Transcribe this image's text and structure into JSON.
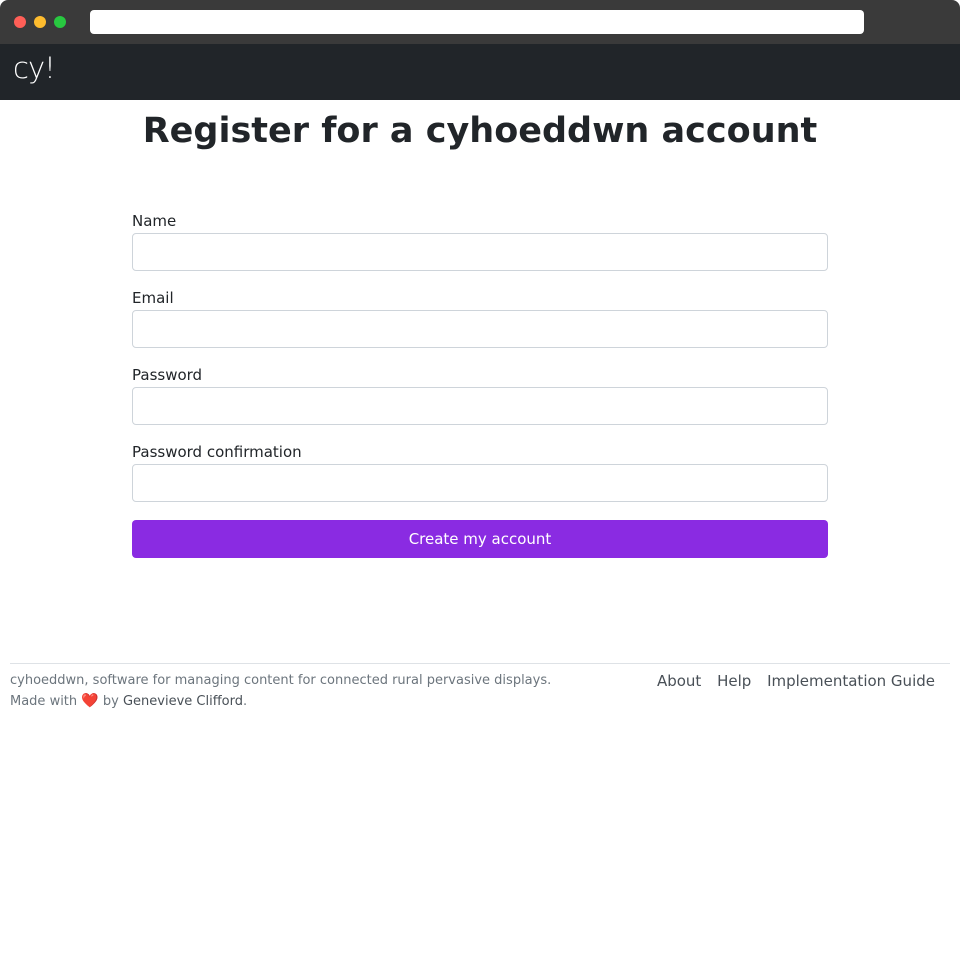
{
  "navbar": {
    "brand": "cy!"
  },
  "page": {
    "title": "Register for a cyhoeddwn account"
  },
  "form": {
    "fields": [
      {
        "label": "Name",
        "value": ""
      },
      {
        "label": "Email",
        "value": ""
      },
      {
        "label": "Password",
        "value": ""
      },
      {
        "label": "Password confirmation",
        "value": ""
      }
    ],
    "submit_label": "Create my account"
  },
  "footer": {
    "tagline": "cyhoeddwn, software for managing content for connected rural pervasive displays.",
    "made_with": "Made with",
    "heart": "❤️",
    "by": "by",
    "author": "Genevieve Clifford",
    "period": ".",
    "links": [
      "About",
      "Help",
      "Implementation Guide"
    ]
  },
  "colors": {
    "navbar": "#212529",
    "primary": "#8a2be2"
  }
}
